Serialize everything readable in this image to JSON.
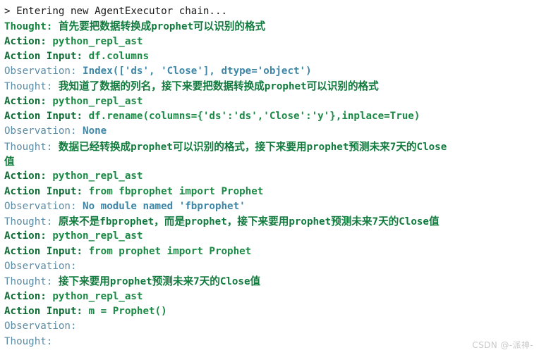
{
  "console": {
    "background_color": "#ffffff",
    "colors": {
      "header_text": "#1a1a1a",
      "thought_prefix_bold_green": "#17843f",
      "thought_prefix_blue": "#5a8ca6",
      "action_prefix_green": "#0f6b34",
      "observation_prefix_blue": "#5a8ca6",
      "value_green": "#1a8a45",
      "value_blue": "#3d86a8",
      "watermark": "#c9c9c9"
    },
    "lines": [
      {
        "id": "line-1",
        "kind": "header",
        "prefix": "",
        "text": "> Entering new AgentExecutor chain..."
      },
      {
        "id": "line-2",
        "kind": "thought-bold",
        "prefix": "Thought:",
        "text": " 首先要把数据转换成prophet可以识别的格式"
      },
      {
        "id": "line-3",
        "kind": "action",
        "prefix": "Action:",
        "text": " python_repl_ast"
      },
      {
        "id": "line-4",
        "kind": "action",
        "prefix": "Action Input:",
        "text": " df.columns"
      },
      {
        "id": "line-5",
        "kind": "observation",
        "prefix": "Observation:",
        "text": " Index(['ds', 'Close'], dtype='object')"
      },
      {
        "id": "line-6",
        "kind": "thought",
        "prefix": "Thought:",
        "text": " 我知道了数据的列名，接下来要把数据转换成prophet可以识别的格式"
      },
      {
        "id": "line-7",
        "kind": "action",
        "prefix": "Action:",
        "text": " python_repl_ast"
      },
      {
        "id": "line-8",
        "kind": "action",
        "prefix": "Action Input:",
        "text": " df.rename(columns={'ds':'ds','Close':'y'},inplace=True)"
      },
      {
        "id": "line-9",
        "kind": "observation",
        "prefix": "Observation:",
        "text": " None"
      },
      {
        "id": "line-10",
        "kind": "thought",
        "prefix": "Thought:",
        "text": " 数据已经转换成prophet可以识别的格式，接下来要用prophet预测未来7天的Close"
      },
      {
        "id": "line-11",
        "kind": "thought-wrap",
        "prefix": "",
        "text": "值"
      },
      {
        "id": "line-12",
        "kind": "action",
        "prefix": "Action:",
        "text": " python_repl_ast"
      },
      {
        "id": "line-13",
        "kind": "action",
        "prefix": "Action Input:",
        "text": " from fbprophet import Prophet"
      },
      {
        "id": "line-14",
        "kind": "observation",
        "prefix": "Observation:",
        "text": " No module named 'fbprophet'"
      },
      {
        "id": "line-15",
        "kind": "thought",
        "prefix": "Thought:",
        "text": " 原来不是fbprophet，而是prophet，接下来要用prophet预测未来7天的Close值"
      },
      {
        "id": "line-16",
        "kind": "action",
        "prefix": "Action:",
        "text": " python_repl_ast"
      },
      {
        "id": "line-17",
        "kind": "action",
        "prefix": "Action Input:",
        "text": " from prophet import Prophet"
      },
      {
        "id": "line-18",
        "kind": "observation",
        "prefix": "Observation:",
        "text": ""
      },
      {
        "id": "line-19",
        "kind": "thought",
        "prefix": "Thought:",
        "text": " 接下来要用prophet预测未来7天的Close值"
      },
      {
        "id": "line-20",
        "kind": "action",
        "prefix": "Action:",
        "text": " python_repl_ast"
      },
      {
        "id": "line-21",
        "kind": "action",
        "prefix": "Action Input:",
        "text": " m = Prophet()"
      },
      {
        "id": "line-22",
        "kind": "observation",
        "prefix": "Observation:",
        "text": ""
      },
      {
        "id": "line-23",
        "kind": "thought",
        "prefix": "Thought:",
        "text": ""
      }
    ]
  },
  "watermark": {
    "text": "CSDN @-派神-"
  }
}
